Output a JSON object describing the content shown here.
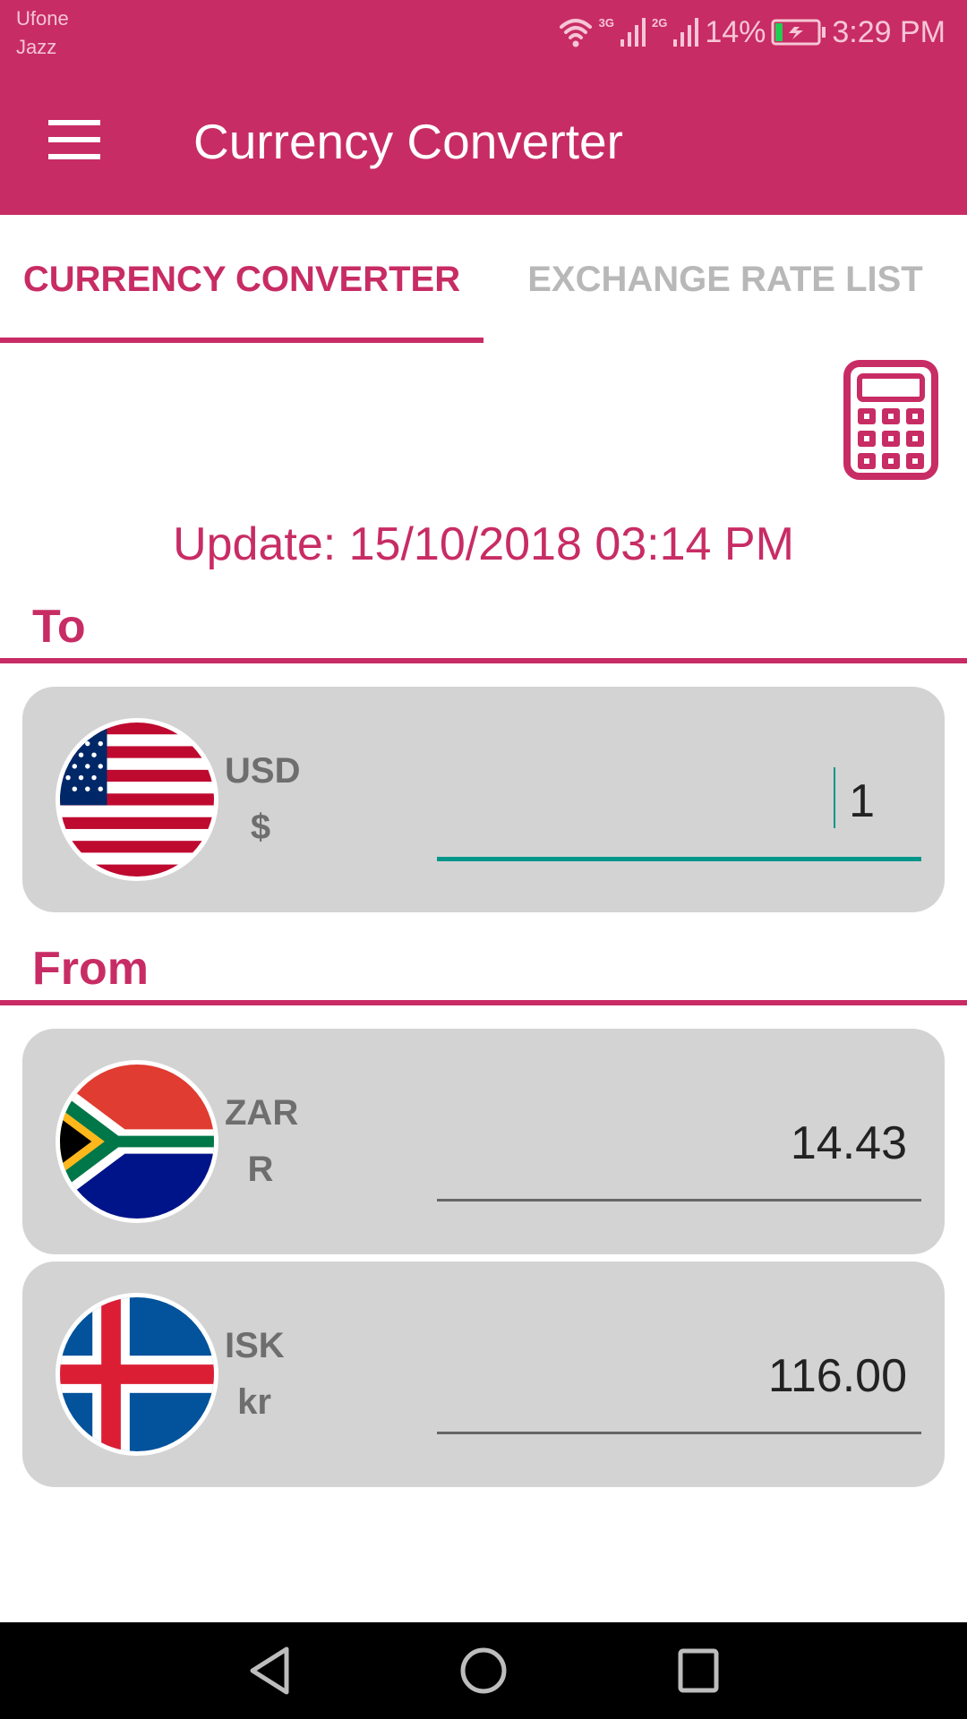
{
  "status_bar": {
    "carriers": [
      "Ufone",
      "Jazz"
    ],
    "network_1": "3G",
    "network_2": "2G",
    "battery": "14%",
    "time": "3:29 PM",
    "icons": [
      "wifi-icon",
      "signal-3g-icon",
      "signal-2g-icon",
      "battery-charging-icon"
    ]
  },
  "app_bar": {
    "title": "Currency Converter",
    "menu_icon": "hamburger-menu-icon"
  },
  "tabs": [
    {
      "label": "CURRENCY CONVERTER",
      "active": true
    },
    {
      "label": "EXCHANGE RATE LIST",
      "active": false
    }
  ],
  "calculator_icon": "calculator-icon",
  "update_text": "Update: 15/10/2018 03:14 PM",
  "to_section": {
    "label": "To",
    "currencies": [
      {
        "code": "USD",
        "symbol": "$",
        "flag": "united-states-flag",
        "amount": "1",
        "focused": true
      }
    ]
  },
  "from_section": {
    "label": "From",
    "currencies": [
      {
        "code": "ZAR",
        "symbol": "R",
        "flag": "south-africa-flag",
        "amount": "14.43",
        "focused": false
      },
      {
        "code": "ISK",
        "symbol": "kr",
        "flag": "iceland-flag",
        "amount": "116.00",
        "focused": false
      }
    ]
  },
  "colors": {
    "primary": "#c82c64",
    "card_bg": "#d3d3d3",
    "focus_underline": "#00968a",
    "inactive_tab": "#b8b8b8",
    "currency_label": "#6e6e6e"
  },
  "nav_bar": {
    "buttons": [
      "back-icon",
      "home-icon",
      "recents-icon"
    ]
  }
}
